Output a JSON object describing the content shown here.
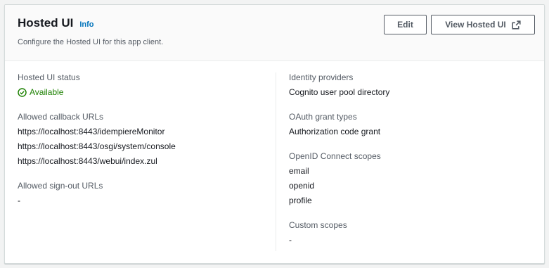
{
  "header": {
    "title": "Hosted UI",
    "info_label": "Info",
    "description": "Configure the Hosted UI for this app client.",
    "edit_label": "Edit",
    "view_label": "View Hosted UI"
  },
  "left": {
    "status_label": "Hosted UI status",
    "status_value": "Available",
    "status_color": "#1d8102",
    "callback_label": "Allowed callback URLs",
    "callback_urls": [
      "https://localhost:8443/idempiereMonitor",
      "https://localhost:8443/osgi/system/console",
      "https://localhost:8443/webui/index.zul"
    ],
    "signout_label": "Allowed sign-out URLs",
    "signout_value": "-"
  },
  "right": {
    "idp_label": "Identity providers",
    "idp_value": "Cognito user pool directory",
    "grant_label": "OAuth grant types",
    "grant_value": "Authorization code grant",
    "scopes_label": "OpenID Connect scopes",
    "scopes": [
      "email",
      "openid",
      "profile"
    ],
    "custom_label": "Custom scopes",
    "custom_value": "-"
  },
  "icons": {
    "status": "check-circle-icon",
    "external": "external-link-icon"
  },
  "colors": {
    "link": "#0073bb",
    "header_bg": "#fafafa"
  }
}
